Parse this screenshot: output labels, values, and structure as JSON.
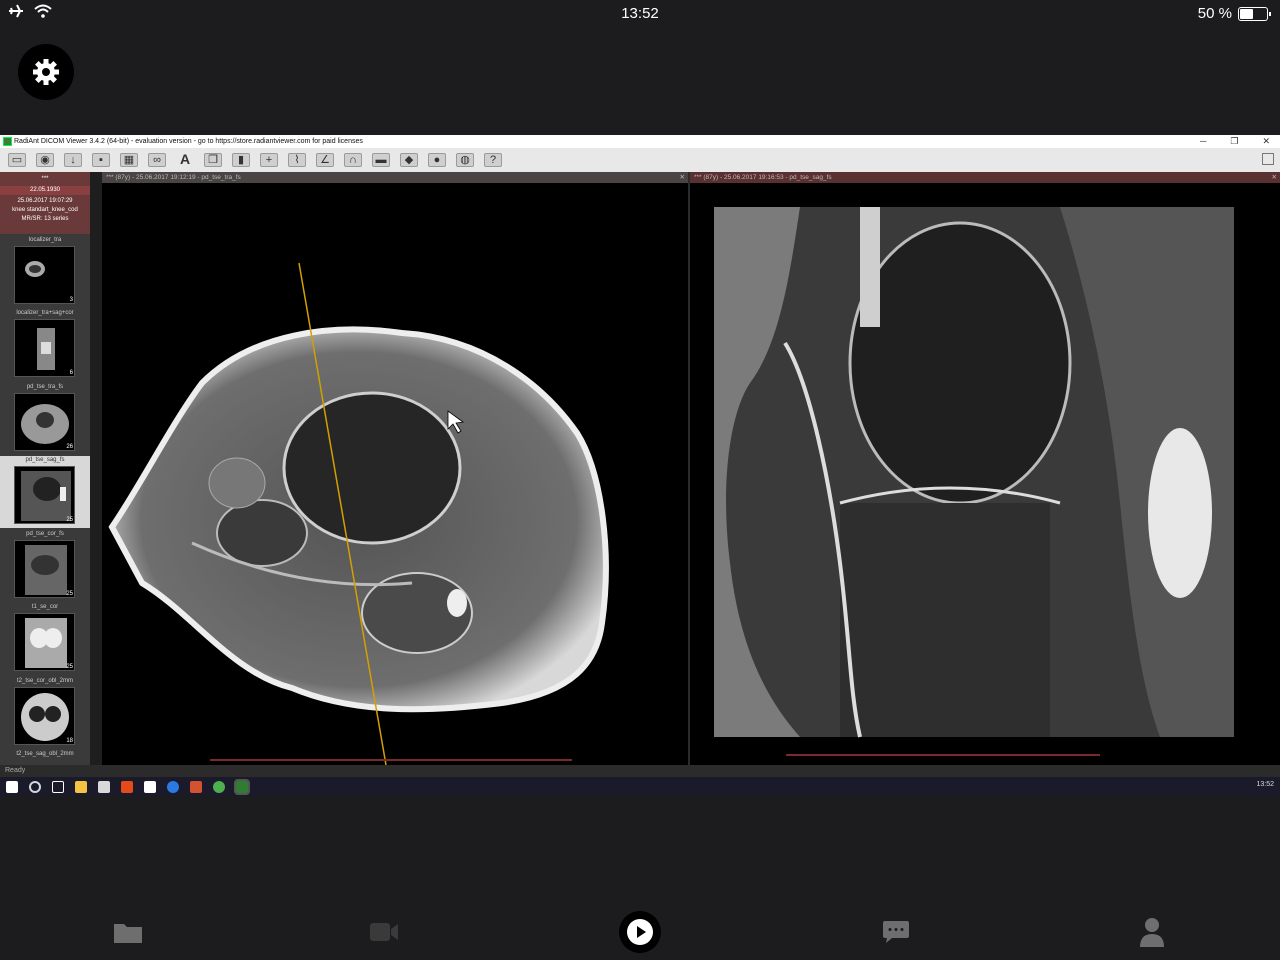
{
  "status_bar": {
    "time": "13:52",
    "battery": "50 %",
    "battery_level": 0.5,
    "icons": [
      "airplane-icon",
      "wifi-icon"
    ]
  },
  "window": {
    "title": "RadiAnt DICOM Viewer 3.4.2 (64-bit) - evaluation version - go to https://store.radiantviewer.com for paid licenses",
    "controls": [
      "─",
      "❐",
      "✕"
    ]
  },
  "toolbar": {
    "text_tool": "A",
    "icons": [
      "open-icon",
      "cd-icon",
      "download-icon",
      "save-icon",
      "layout-icon",
      "link-icon",
      "text-icon",
      "copy-icon",
      "sync-icon",
      "crosshair-icon",
      "ruler-icon",
      "angle-icon",
      "filter-icon",
      "export-icon",
      "cube-icon",
      "color-icon",
      "fusion-icon",
      "help-icon"
    ]
  },
  "patient": {
    "name": "***",
    "dob": "22.05.1930",
    "study_date": "25.06.2017 19:07:29",
    "study_desc": "knee standart_knee_cod",
    "modality": "MR/SR: 13 series"
  },
  "series": [
    {
      "label": "localizer_tra",
      "count": "3"
    },
    {
      "label": "localizer_tra+sag+cor",
      "count": "6"
    },
    {
      "label": "pd_tse_tra_fs",
      "count": "26"
    },
    {
      "label": "pd_tse_sag_fs",
      "count": "25"
    },
    {
      "label": "pd_tse_cor_fs",
      "count": "25"
    },
    {
      "label": "t1_se_cor",
      "count": "25"
    },
    {
      "label": "t2_tse_cor_obl_2mm",
      "count": "18"
    },
    {
      "label": "t2_tse_sag_obl_2mm",
      "count": ""
    }
  ],
  "viewports": {
    "left_header": "*** (87y) - 25.06.2017 19:12:19 - pd_tse_tra_fs",
    "right_header": "*** (87y) - 25.06.2017 19:16:53 - pd_tse_sag_fs",
    "close": "✕"
  },
  "statusline": "Ready",
  "taskbar": {
    "clock": "13:52",
    "colors": [
      "#ffffff",
      "#cfd8dc",
      "#ffffff",
      "#f5c342",
      "#d9d9d9",
      "#e64a19",
      "#ffffff",
      "#2a7ae2",
      "#d35230",
      "#4caf50",
      "#2e7d32"
    ]
  },
  "tabbar": {
    "tabs": [
      "folder-icon",
      "video-icon",
      "play-icon",
      "chat-icon",
      "profile-icon"
    ]
  }
}
